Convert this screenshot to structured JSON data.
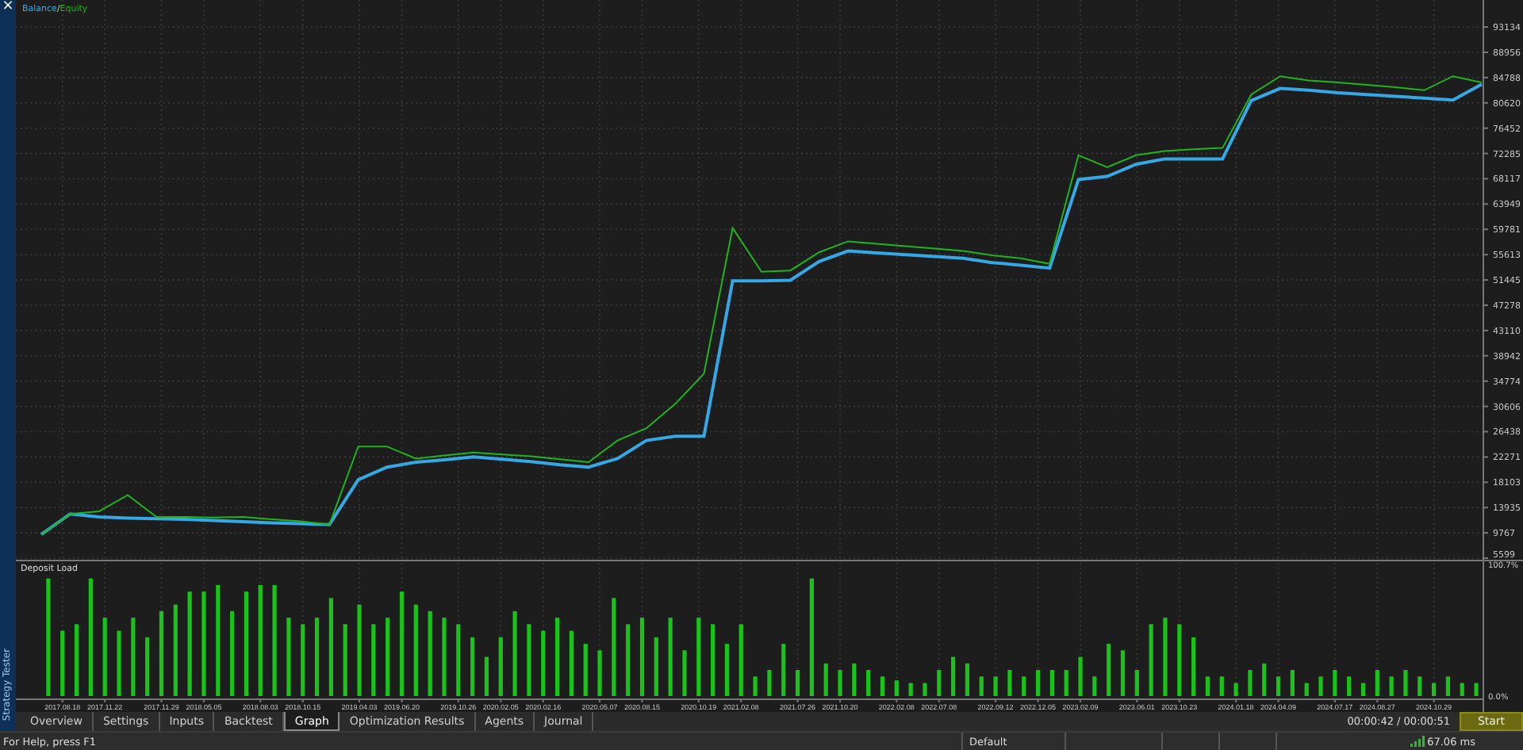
{
  "side_panel": {
    "close": "×",
    "title": "Strategy Tester"
  },
  "graph": {
    "legend_separator": "/",
    "chart_data": {
      "type": "line",
      "grid": true,
      "series": [
        {
          "name": "Balance",
          "color": "#35a9e6",
          "values": [
            9500,
            12900,
            12400,
            12200,
            12100,
            12000,
            11800,
            11600,
            11400,
            11300,
            11100,
            18500,
            20600,
            21400,
            21800,
            22300,
            21900,
            21500,
            21000,
            20600,
            22000,
            25000,
            25700,
            25700,
            51300,
            51300,
            51400,
            54500,
            56200,
            55900,
            55600,
            55300,
            55000,
            54300,
            53900,
            53400,
            68000,
            68500,
            70500,
            71400,
            71400,
            71400,
            81000,
            83000,
            82700,
            82300,
            82000,
            81700,
            81400,
            81100,
            83700
          ]
        },
        {
          "name": "Equity",
          "color": "#1fb51f",
          "values": [
            9500,
            12900,
            13300,
            16000,
            12400,
            12400,
            12300,
            12400,
            12000,
            11700,
            11100,
            24000,
            24000,
            22000,
            22500,
            23000,
            22700,
            22400,
            21900,
            21400,
            25000,
            27000,
            31000,
            36000,
            60000,
            52800,
            53000,
            56000,
            57800,
            57400,
            57000,
            56600,
            56200,
            55500,
            55000,
            54100,
            72000,
            70000,
            72000,
            72700,
            73000,
            73200,
            82000,
            85000,
            84300,
            84000,
            83600,
            83200,
            82700,
            85000,
            84000
          ]
        }
      ],
      "ylim": [
        5338,
        97576
      ],
      "yticks": [
        93134,
        88956,
        84788,
        80620,
        76452,
        72285,
        68117,
        63949,
        59781,
        55613,
        51445,
        47278,
        43110,
        38942,
        34774,
        30606,
        26438,
        22271,
        18103,
        13935,
        9767,
        5599
      ]
    }
  },
  "deposit_load": {
    "chart_data": {
      "type": "bar",
      "grid": true,
      "title": "Deposit Load",
      "categories": [
        null,
        "2017.08.18",
        null,
        null,
        "2017.11.22",
        null,
        null,
        null,
        "2017.11.29",
        null,
        null,
        "2018.05.05",
        null,
        null,
        null,
        "2018.08.03",
        null,
        null,
        "2018.10.15",
        null,
        null,
        null,
        "2019.04.03",
        null,
        null,
        "2019.06.20",
        null,
        null,
        null,
        "2019.10.26",
        null,
        null,
        "2020.02.05",
        null,
        null,
        "2020.02.16",
        null,
        null,
        null,
        "2020.05.07",
        null,
        null,
        "2020.08.15",
        null,
        null,
        null,
        "2020.10.19",
        null,
        null,
        "2021.02.08",
        null,
        null,
        null,
        "2021.07.26",
        null,
        null,
        "2021.10.20",
        null,
        null,
        null,
        "2022.02.08",
        null,
        null,
        "2022.07.08",
        null,
        null,
        null,
        "2022.09.12",
        null,
        null,
        "2022.12.05",
        null,
        null,
        "2023.02.09",
        null,
        null,
        null,
        "2023.06.01",
        null,
        null,
        "2023.10.23",
        null,
        null,
        null,
        "2024.01.18",
        null,
        null,
        "2024.04.09",
        null,
        null,
        null,
        "2024.07.17",
        null,
        null,
        "2024.08.27",
        null,
        null,
        null,
        "2024.10.29",
        null,
        null,
        null
      ],
      "values": [
        90,
        50,
        55,
        90,
        60,
        50,
        60,
        45,
        65,
        70,
        80,
        80,
        85,
        65,
        80,
        85,
        85,
        60,
        55,
        60,
        75,
        55,
        70,
        55,
        60,
        80,
        70,
        65,
        60,
        55,
        45,
        30,
        45,
        65,
        55,
        50,
        60,
        50,
        40,
        35,
        75,
        55,
        60,
        45,
        60,
        35,
        60,
        55,
        40,
        55,
        15,
        20,
        40,
        20,
        90,
        25,
        20,
        25,
        20,
        15,
        12,
        10,
        10,
        20,
        30,
        25,
        15,
        15,
        20,
        15,
        20,
        20,
        20,
        30,
        15,
        40,
        35,
        20,
        55,
        60,
        55,
        45,
        15,
        15,
        10,
        20,
        25,
        15,
        20,
        10,
        15,
        20,
        15,
        10,
        20,
        15,
        20,
        15,
        10,
        15,
        10,
        10
      ],
      "color": "#19c319",
      "ylim": [
        0,
        100.7
      ],
      "yticks": [
        {
          "value": 100.7,
          "label": "100.7%"
        },
        {
          "value": 0,
          "label": "0.0%"
        }
      ]
    }
  },
  "tabs": [
    {
      "label": "Overview",
      "selected": false
    },
    {
      "label": "Settings",
      "selected": false
    },
    {
      "label": "Inputs",
      "selected": false
    },
    {
      "label": "Backtest",
      "selected": false
    },
    {
      "label": "Graph",
      "selected": true
    },
    {
      "label": "Optimization Results",
      "selected": false
    },
    {
      "label": "Agents",
      "selected": false
    },
    {
      "label": "Journal",
      "selected": false
    }
  ],
  "timer": "00:00:42 / 00:00:51",
  "start_button": "Start",
  "status_bar": {
    "help": "For Help, press F1",
    "profile": "Default",
    "ping": "67.06 ms"
  }
}
